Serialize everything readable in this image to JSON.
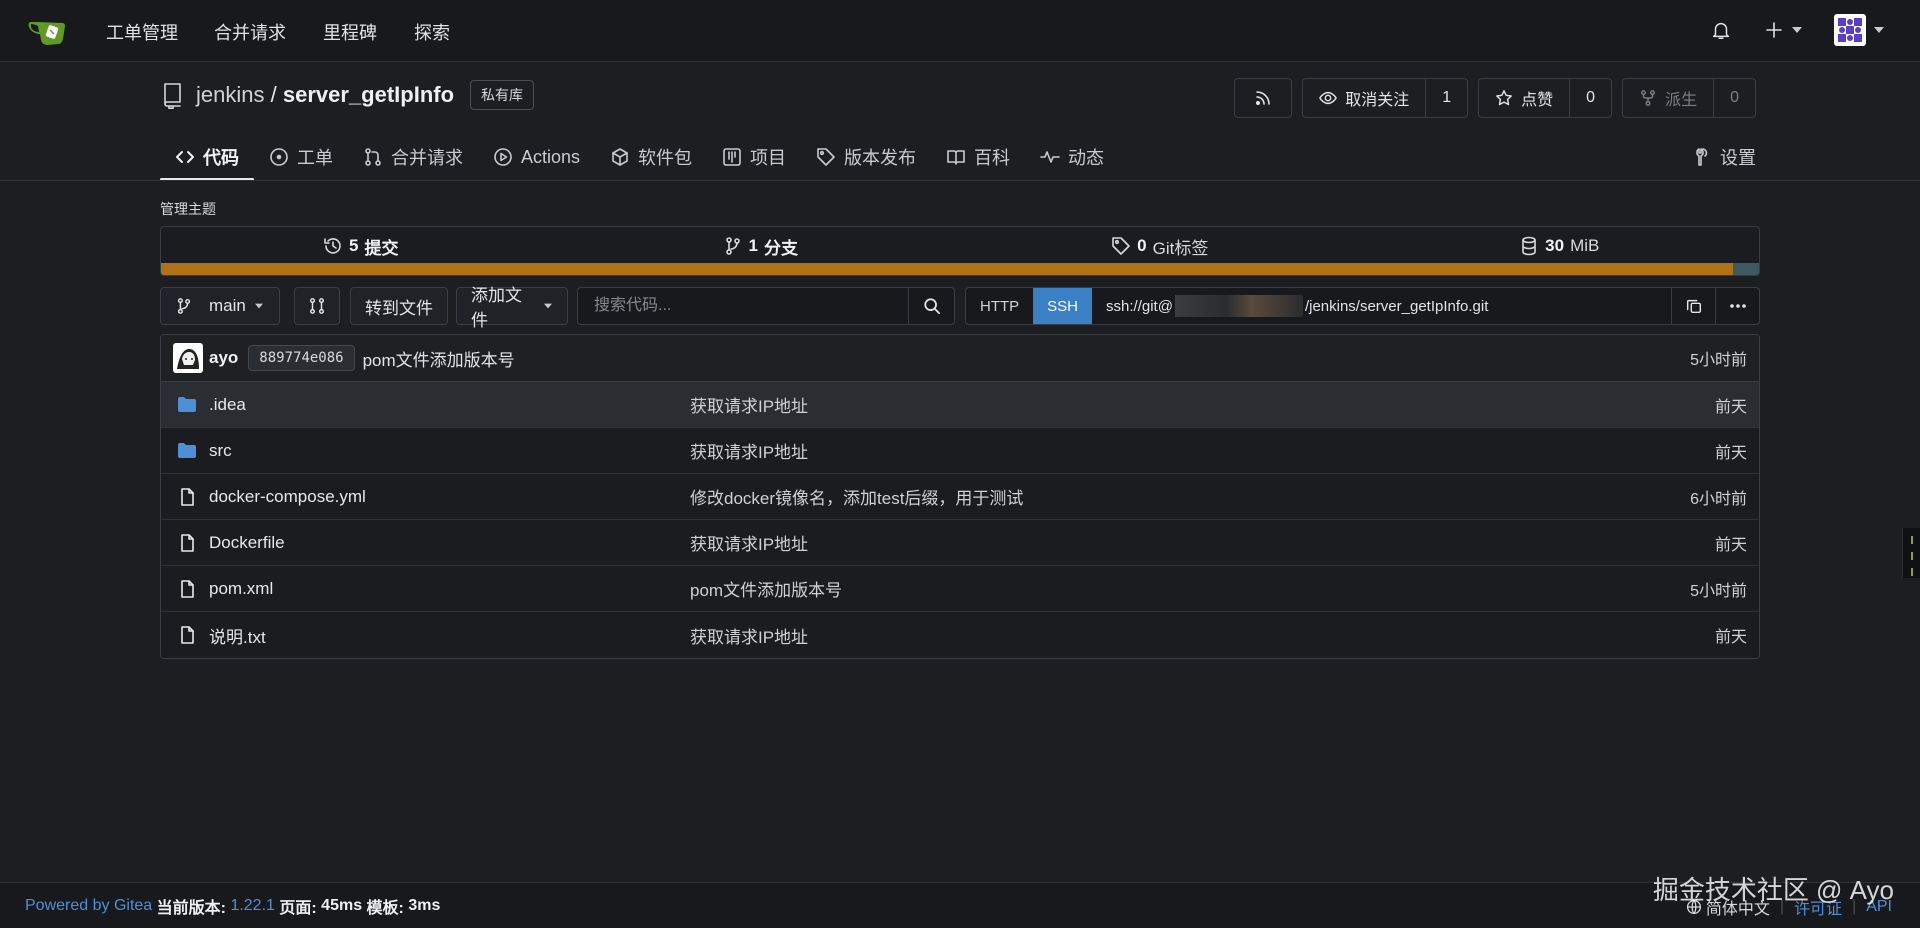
{
  "navbar": {
    "items": [
      "工单管理",
      "合并请求",
      "里程碑",
      "探索"
    ]
  },
  "repo": {
    "owner": "jenkins",
    "separator": "/",
    "name": "server_getIpInfo",
    "visibility": "私有库"
  },
  "actions": {
    "watch_label": "取消关注",
    "watch_count": "1",
    "star_label": "点赞",
    "star_count": "0",
    "fork_label": "派生",
    "fork_count": "0"
  },
  "tabs": [
    "代码",
    "工单",
    "合并请求",
    "Actions",
    "软件包",
    "项目",
    "版本发布",
    "百科",
    "动态"
  ],
  "settings_label": "设置",
  "manage_topics": "管理主题",
  "stats": {
    "commits_num": "5",
    "commits_label": "提交",
    "branches_num": "1",
    "branches_label": "分支",
    "tags_num": "0",
    "tags_label": "Git标签",
    "size_num": "30",
    "size_label": "MiB"
  },
  "language_bar": {
    "primary_color": "#b07219",
    "secondary_color": "#3d5a63",
    "primary_fraction": 0.9835
  },
  "toolbar": {
    "branch": "main",
    "goto_file": "转到文件",
    "add_file": "添加文件",
    "search_placeholder": "搜索代码...",
    "clone_http": "HTTP",
    "clone_ssh": "SSH",
    "clone_url_prefix": "ssh://git@",
    "clone_url_suffix": "/jenkins/server_getIpInfo.git"
  },
  "latest_commit": {
    "author": "ayo",
    "sha": "889774e086",
    "message": "pom文件添加版本号",
    "time": "5小时前"
  },
  "files": [
    {
      "type": "dir",
      "name": ".idea",
      "message": "获取请求IP地址",
      "time": "前天"
    },
    {
      "type": "dir",
      "name": "src",
      "message": "获取请求IP地址",
      "time": "前天"
    },
    {
      "type": "file",
      "name": "docker-compose.yml",
      "message": "修改docker镜像名，添加test后缀，用于测试",
      "time": "6小时前"
    },
    {
      "type": "file",
      "name": "Dockerfile",
      "message": "获取请求IP地址",
      "time": "前天"
    },
    {
      "type": "file",
      "name": "pom.xml",
      "message": "pom文件添加版本号",
      "time": "5小时前"
    },
    {
      "type": "file",
      "name": "说明.txt",
      "message": "获取请求IP地址",
      "time": "前天"
    }
  ],
  "footer": {
    "powered": "Powered by Gitea",
    "version_label": "当前版本:",
    "version": "1.22.1",
    "page_label": "页面:",
    "page_time": "45ms",
    "template_label": "模板:",
    "template_time": "3ms",
    "language": "简体中文",
    "license": "许可证",
    "api": "API"
  },
  "watermark": "掘金技术社区 @ Ayo",
  "colors": {
    "accent_blue": "#3b7fc4",
    "folder_blue": "#4f8fd6",
    "link_blue": "#4f8fd6"
  }
}
